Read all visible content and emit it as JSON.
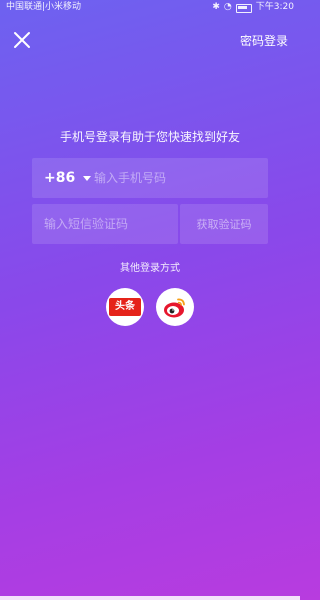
{
  "status_bar": {
    "carrier": "中国联通|小米移动",
    "time": "下午3:20"
  },
  "header": {
    "password_login_label": "密码登录"
  },
  "subtitle": "手机号登录有助于您快速找到好友",
  "phone": {
    "country_code": "+86",
    "placeholder": "输入手机号码"
  },
  "code": {
    "placeholder": "输入短信验证码",
    "get_code_label": "获取验证码"
  },
  "other_login": {
    "label": "其他登录方式",
    "providers": [
      {
        "name": "toutiao",
        "badge_text": "头条",
        "icon": "toutiao-icon",
        "color": "#e5231a"
      },
      {
        "name": "weibo",
        "icon": "weibo-icon",
        "color": "#e6162d"
      }
    ]
  },
  "colors": {
    "gradient_start": "#6d62f0",
    "gradient_end": "#b83cdf"
  }
}
